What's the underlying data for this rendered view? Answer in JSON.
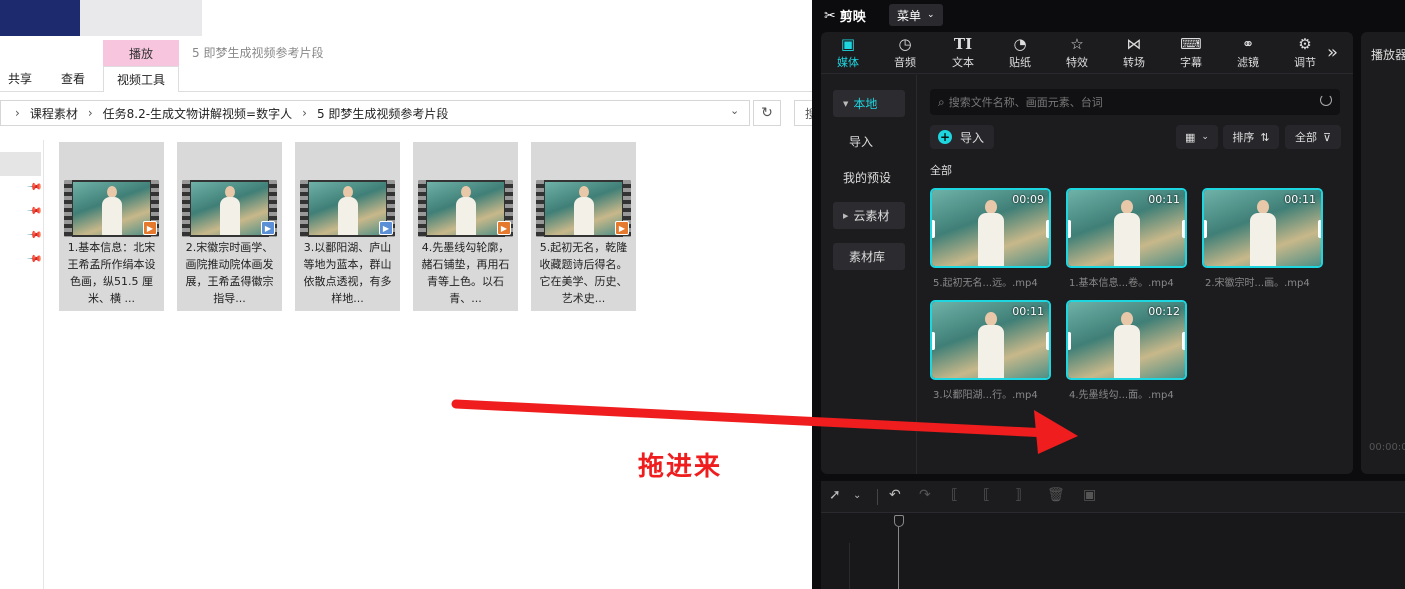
{
  "explorer": {
    "ribbon": {
      "context_tab": "播放",
      "tabs": [
        "共享",
        "查看",
        "视频工具"
      ]
    },
    "window_title": "5 即梦生成视频参考片段",
    "breadcrumb": [
      "课程素材",
      "任务8.2-生成文物讲解视频=数字人",
      "5 即梦生成视频参考片段"
    ],
    "search_placeholder": "搜",
    "files": [
      {
        "label": "1.基本信息：北宋王希孟所作绢本设色画，纵51.5 厘米、横 ..."
      },
      {
        "label": "2.宋徽宗时画学、画院推动院体画发展，王希孟得徽宗指导..."
      },
      {
        "label": "3.以鄱阳湖、庐山等地为蓝本，群山依散点透视，有多样地..."
      },
      {
        "label": "4.先墨线勾轮廓，赭石铺垫，再用石青等上色。以石青、..."
      },
      {
        "label": "5.起初无名，乾隆收藏题诗后得名。它在美学、历史、艺术史..."
      }
    ]
  },
  "annotation": {
    "text": "拖进来",
    "color": "#ef1d1d"
  },
  "capcut": {
    "app_name": "剪映",
    "menu_label": "菜单",
    "toolbar": [
      {
        "icon": "media-icon",
        "label": "媒体"
      },
      {
        "icon": "audio-icon",
        "label": "音频"
      },
      {
        "icon": "text-icon",
        "label": "文本"
      },
      {
        "icon": "sticker-icon",
        "label": "贴纸"
      },
      {
        "icon": "effects-icon",
        "label": "特效"
      },
      {
        "icon": "transition-icon",
        "label": "转场"
      },
      {
        "icon": "caption-icon",
        "label": "字幕"
      },
      {
        "icon": "filter-icon",
        "label": "滤镜"
      },
      {
        "icon": "adjust-icon",
        "label": "调节"
      }
    ],
    "sidebar": {
      "local": "本地",
      "import": "导入",
      "my_presets": "我的预设",
      "cloud": "云素材",
      "library": "素材库"
    },
    "search_placeholder": "搜索文件名称、画面元素、台词",
    "import_label": "导入",
    "sort_label": "排序",
    "filter_label": "全部",
    "section_label": "全部",
    "clips": [
      {
        "duration": "00:09",
        "name": "5.起初无名...远。.mp4"
      },
      {
        "duration": "00:11",
        "name": "1.基本信息...卷。.mp4"
      },
      {
        "duration": "00:11",
        "name": "2.宋徽宗时...画。.mp4"
      },
      {
        "duration": "00:11",
        "name": "3.以鄱阳湖...行。.mp4"
      },
      {
        "duration": "00:12",
        "name": "4.先墨线勾...面。.mp4"
      }
    ],
    "player": {
      "title": "播放器",
      "time": "00:00:0"
    },
    "accent_color": "#1ed6e0"
  }
}
